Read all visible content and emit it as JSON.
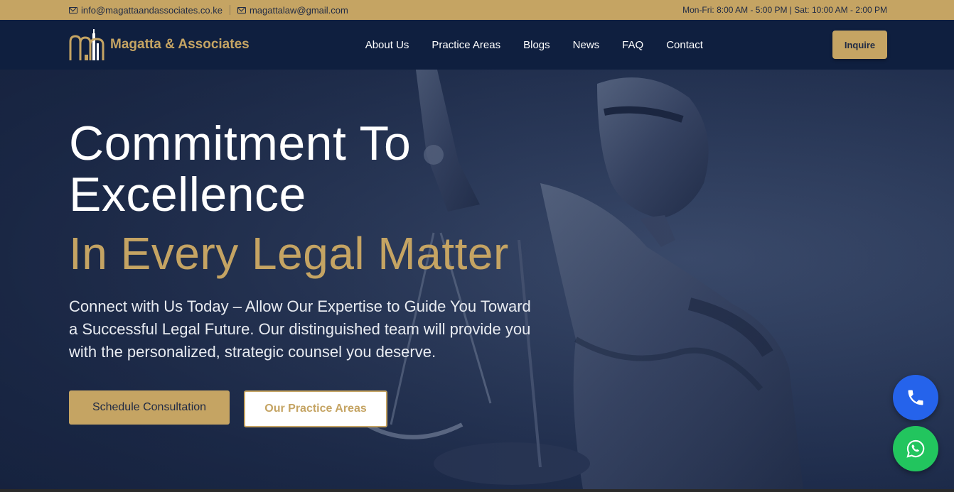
{
  "topbar": {
    "email_1": "info@magattaandassociates.co.ke",
    "email_2": "magattalaw@gmail.com",
    "hours": "Mon-Fri: 8:00 AM - 5:00 PM | Sat: 10:00 AM - 2:00 PM",
    "background_color": "#c5a463"
  },
  "navbar": {
    "brand_name": "Magatta & Associates",
    "links": [
      "About Us",
      "Practice Areas",
      "Blogs",
      "News",
      "FAQ",
      "Contact"
    ],
    "inquire_label": "Inquire",
    "background_color": "#0f1f3f"
  },
  "hero": {
    "headline_line1": "Commitment To",
    "headline_line2": "Excellence",
    "headline_gold": "In Every Legal Matter",
    "subtext": "Connect with Us Today – Allow Our Expertise to Guide You Toward a Successful Legal Future. Our distinguished team will provide you with the personalized, strategic counsel you deserve.",
    "primary_cta": "Schedule Consultation",
    "secondary_cta": "Our Practice Areas",
    "accent_color": "#c5a463"
  },
  "floating_actions": {
    "phone_icon": "phone-icon",
    "whatsapp_icon": "whatsapp-icon",
    "phone_color": "#2563eb",
    "whatsapp_color": "#22c55e"
  }
}
